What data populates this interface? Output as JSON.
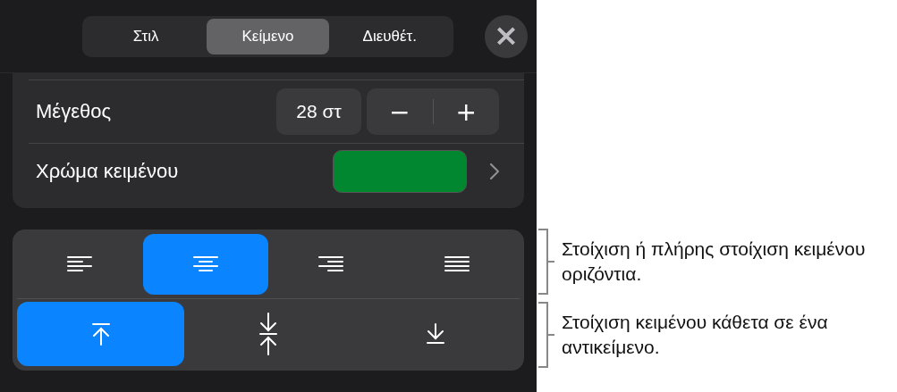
{
  "tabs": [
    {
      "label": "Στιλ",
      "selected": false
    },
    {
      "label": "Κείμενο",
      "selected": true
    },
    {
      "label": "Διευθέτ.",
      "selected": false
    }
  ],
  "close_button": "×",
  "size": {
    "label": "Μέγεθος",
    "value": "28 στ",
    "decrement": "−",
    "increment": "+"
  },
  "text_color": {
    "label": "Χρώμα κειμένου",
    "color": "#00872f"
  },
  "horizontal_alignment": [
    {
      "kind": "left",
      "selected": false
    },
    {
      "kind": "center",
      "selected": true
    },
    {
      "kind": "right",
      "selected": false
    },
    {
      "kind": "justify",
      "selected": false
    }
  ],
  "vertical_alignment": [
    {
      "kind": "top",
      "selected": true
    },
    {
      "kind": "middle",
      "selected": false
    },
    {
      "kind": "bottom",
      "selected": false
    }
  ],
  "callouts": [
    "Στοίχιση ή πλήρης στοίχιση κειμένου οριζόντια.",
    "Στοίχιση κειμένου κάθετα σε ένα αντικείμενο."
  ]
}
